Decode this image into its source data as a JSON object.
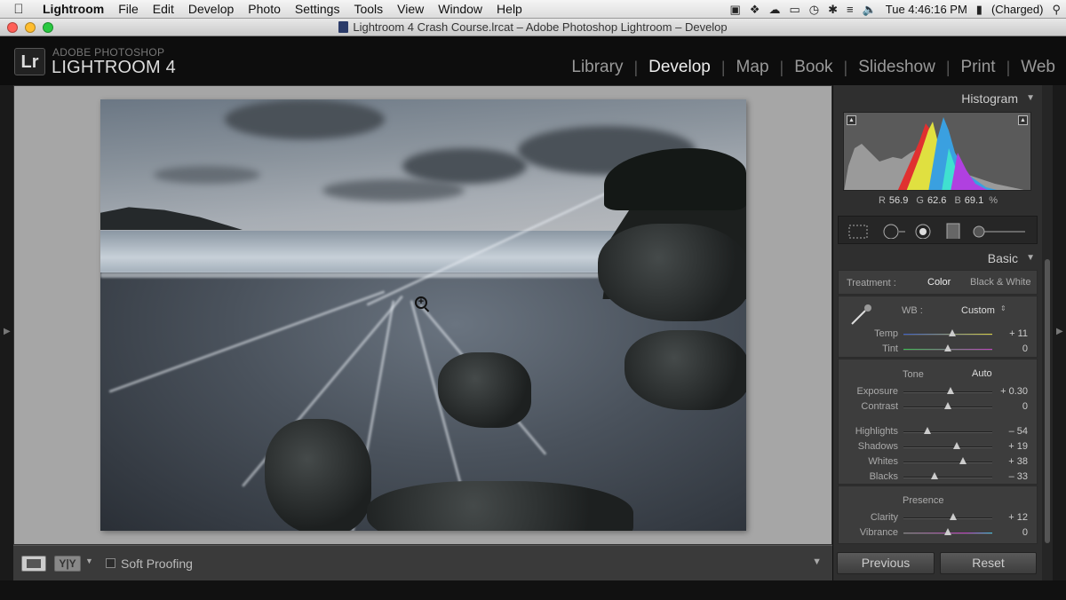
{
  "menubar": {
    "app_name": "Lightroom",
    "items": [
      "File",
      "Edit",
      "Develop",
      "Photo",
      "Settings",
      "Tools",
      "View",
      "Window",
      "Help"
    ],
    "clock": "Tue 4:46:16 PM",
    "battery": "(Charged)"
  },
  "window": {
    "title": "Lightroom 4 Crash Course.lrcat – Adobe Photoshop Lightroom – Develop"
  },
  "identity": {
    "logo": "Lr",
    "line1": "ADOBE PHOTOSHOP",
    "line2": "LIGHTROOM 4"
  },
  "modules": [
    "Library",
    "Develop",
    "Map",
    "Book",
    "Slideshow",
    "Print",
    "Web"
  ],
  "active_module": "Develop",
  "toolbar": {
    "yy": "Y|Y",
    "soft_proofing": "Soft Proofing",
    "soft_proofing_checked": false
  },
  "histogram": {
    "header": "Histogram",
    "r_label": "R",
    "r": "56.9",
    "g_label": "G",
    "g": "62.6",
    "b_label": "B",
    "b": "69.1",
    "unit": "%"
  },
  "basic": {
    "header": "Basic",
    "treatment_label": "Treatment :",
    "treatment_color": "Color",
    "treatment_bw": "Black & White",
    "wb_label": "WB :",
    "wb_value": "Custom",
    "tone_label": "Tone",
    "auto_label": "Auto",
    "presence_label": "Presence",
    "sliders": [
      {
        "label": "Temp",
        "value": "+ 11",
        "pos": 0.55
      },
      {
        "label": "Tint",
        "value": "0",
        "pos": 0.5
      },
      {
        "label": "Exposure",
        "value": "+ 0.30",
        "pos": 0.53
      },
      {
        "label": "Contrast",
        "value": "0",
        "pos": 0.5
      },
      {
        "label": "Highlights",
        "value": "– 54",
        "pos": 0.27
      },
      {
        "label": "Shadows",
        "value": "+ 19",
        "pos": 0.6
      },
      {
        "label": "Whites",
        "value": "+ 38",
        "pos": 0.67
      },
      {
        "label": "Blacks",
        "value": "– 33",
        "pos": 0.35
      },
      {
        "label": "Clarity",
        "value": "+ 12",
        "pos": 0.56
      },
      {
        "label": "Vibrance",
        "value": "0",
        "pos": 0.5
      }
    ]
  },
  "buttons": {
    "previous": "Previous",
    "reset": "Reset"
  }
}
